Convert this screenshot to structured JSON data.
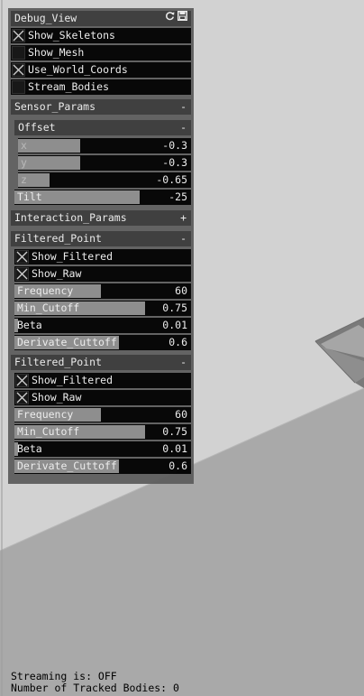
{
  "debug_view": {
    "title": "Debug_View",
    "icons": [
      "refresh-icon",
      "save-icon"
    ],
    "toggles": [
      {
        "label": "Show_Skeletons",
        "checked": true
      },
      {
        "label": "Show_Mesh",
        "checked": false
      },
      {
        "label": "Use_World_Coords",
        "checked": true
      },
      {
        "label": "Stream_Bodies",
        "checked": false
      }
    ]
  },
  "sensor_params": {
    "title": "Sensor_Params",
    "toggle": "-",
    "offset": {
      "title": "Offset",
      "toggle": "-",
      "sliders": [
        {
          "label": "x",
          "value": "-0.3",
          "fill": 0.36
        },
        {
          "label": "y",
          "value": "-0.3",
          "fill": 0.36
        },
        {
          "label": "z",
          "value": "-0.65",
          "fill": 0.18
        }
      ]
    },
    "tilt": {
      "label": "Tilt",
      "value": "-25",
      "fill": 0.71
    }
  },
  "interaction_params": {
    "title": "Interaction_Params",
    "toggle": "+"
  },
  "filtered_points": [
    {
      "title": "Filtered_Point",
      "toggle": "-",
      "toggles": [
        {
          "label": "Show_Filtered",
          "checked": true
        },
        {
          "label": "Show_Raw",
          "checked": true
        }
      ],
      "sliders": [
        {
          "label": "Frequency",
          "value": "60",
          "fill": 0.49
        },
        {
          "label": "Min_Cutoff",
          "value": "0.75",
          "fill": 0.74
        },
        {
          "label": "Beta",
          "value": "0.01",
          "fill": 0.02
        },
        {
          "label": "Derivate_Cuttoff",
          "value": "0.6",
          "fill": 0.59
        }
      ]
    },
    {
      "title": "Filtered_Point",
      "toggle": "-",
      "toggles": [
        {
          "label": "Show_Filtered",
          "checked": true
        },
        {
          "label": "Show_Raw",
          "checked": true
        }
      ],
      "sliders": [
        {
          "label": "Frequency",
          "value": "60",
          "fill": 0.49
        },
        {
          "label": "Min_Cutoff",
          "value": "0.75",
          "fill": 0.74
        },
        {
          "label": "Beta",
          "value": "0.01",
          "fill": 0.02
        },
        {
          "label": "Derivate_Cuttoff",
          "value": "0.6",
          "fill": 0.59
        }
      ]
    }
  ],
  "status": {
    "streaming": "Streaming is: OFF",
    "tracked": "Number of Tracked Bodies: 0"
  },
  "colors": {
    "panel_bg": "#5f5f5f",
    "header_bg": "#3b3b3b",
    "slider_fill": "#8c8c8c",
    "floor_light": "#d2d2d2",
    "floor_dark": "#a9a9a9"
  }
}
